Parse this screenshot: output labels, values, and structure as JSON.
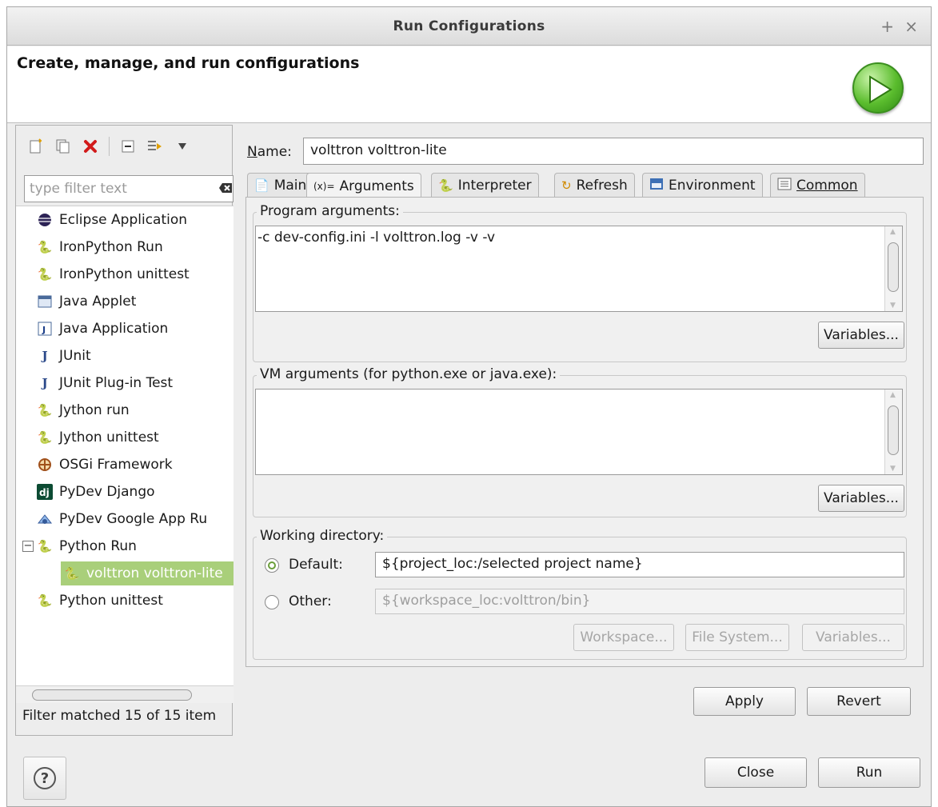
{
  "window": {
    "title": "Run Configurations",
    "plus_glyph": "+",
    "close_glyph": "×"
  },
  "banner": {
    "heading": "Create, manage, and run configurations"
  },
  "left": {
    "filter_placeholder": "type filter text",
    "items": [
      {
        "label": "Eclipse Application",
        "icon": "eclipse-icon"
      },
      {
        "label": "IronPython Run",
        "icon": "ironpython-run-icon"
      },
      {
        "label": "IronPython unittest",
        "icon": "ironpython-unittest-icon"
      },
      {
        "label": "Java Applet",
        "icon": "java-applet-icon"
      },
      {
        "label": "Java Application",
        "icon": "java-application-icon"
      },
      {
        "label": "JUnit",
        "icon": "junit-icon"
      },
      {
        "label": "JUnit Plug-in Test",
        "icon": "junit-plugin-icon"
      },
      {
        "label": "Jython run",
        "icon": "jython-run-icon"
      },
      {
        "label": "Jython unittest",
        "icon": "jython-unittest-icon"
      },
      {
        "label": "OSGi Framework",
        "icon": "osgi-icon"
      },
      {
        "label": "PyDev Django",
        "icon": "django-icon"
      },
      {
        "label": "PyDev Google App Ru",
        "icon": "google-app-icon"
      },
      {
        "label": "Python Run",
        "icon": "python-run-icon"
      },
      {
        "label": "volttron volttron-lite",
        "icon": "python-run-icon"
      },
      {
        "label": "Python unittest",
        "icon": "python-unittest-icon"
      }
    ],
    "status": "Filter matched 15 of 15 item"
  },
  "main": {
    "name_label": "Name:",
    "name_value": "volttron volttron-lite",
    "tabs": [
      {
        "label": "Main",
        "icon": "main-tab-icon"
      },
      {
        "label": "Arguments",
        "icon": "arguments-tab-icon"
      },
      {
        "label": "Interpreter",
        "icon": "python-icon"
      },
      {
        "label": "Refresh",
        "icon": "refresh-icon"
      },
      {
        "label": "Environment",
        "icon": "environment-icon"
      },
      {
        "label": "Common",
        "icon": "common-icon"
      }
    ],
    "program_args_label": "Program arguments:",
    "program_args_value": "-c dev-config.ini -l volttron.log -v -v",
    "vm_args_label": "VM arguments (for python.exe or java.exe):",
    "vm_args_value": "",
    "variables_label": "Variables...",
    "working_dir_label": "Working directory:",
    "default_label": "Default:",
    "default_value": "${project_loc:/selected project name}",
    "other_label": "Other:",
    "other_value": "${workspace_loc:volttron/bin}",
    "workspace_label": "Workspace...",
    "filesystem_label": "File System...",
    "apply_label": "Apply",
    "revert_label": "Revert"
  },
  "footer": {
    "close_label": "Close",
    "run_label": "Run",
    "help_glyph": "?"
  }
}
